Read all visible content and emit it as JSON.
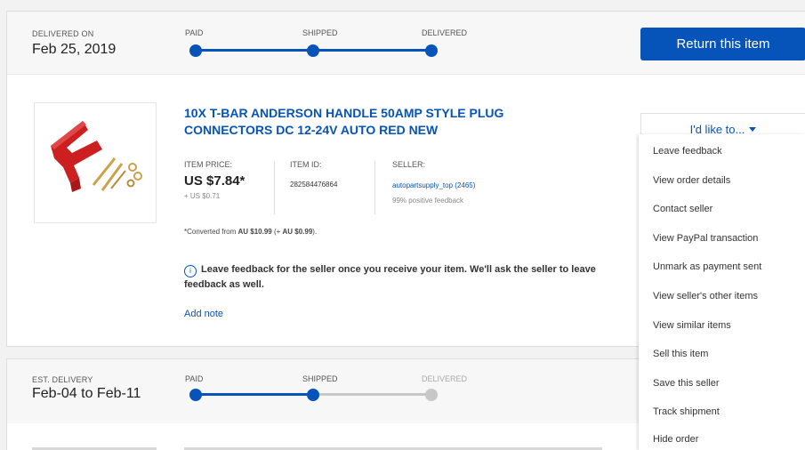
{
  "order1": {
    "date_label": "DELIVERED ON",
    "date_value": "Feb 25, 2019",
    "steps": [
      "PAID",
      "SHIPPED",
      "DELIVERED"
    ],
    "progress_steps_completed": 3,
    "return_button": "Return this item",
    "item": {
      "title": "10x T-BAR ANDERSON HANDLE 50AMP STYLE PLUG CONNECTORS DC 12-24V AUTO RED NEW",
      "price_label": "ITEM PRICE:",
      "price": "US $7.84*",
      "shipping": "+ US $0.71",
      "id_label": "ITEM ID:",
      "id_value": "282584476864",
      "seller_label": "SELLER:",
      "seller_name": "autopartsupply_top (2465)",
      "seller_feedback": "99% positive feedback",
      "converted_prefix": "*Converted from ",
      "converted_amount": "AU $10.99",
      "converted_mid": " (+ ",
      "converted_shipping": "AU $0.99",
      "converted_suffix": ").",
      "info_text": "Leave feedback for the seller once you receive your item. We'll ask the seller to leave feedback as well.",
      "add_note": "Add note"
    },
    "actions": {
      "button_label": "I'd like to...",
      "menu": [
        "Leave feedback",
        "View order details",
        "Contact seller",
        "View PayPal transaction",
        "Unmark as payment sent",
        "View seller's other items",
        "View similar items",
        "Sell this item",
        "Save this seller",
        "Track shipment",
        "Hide order"
      ]
    }
  },
  "order2": {
    "date_label": "EST. DELIVERY",
    "date_value": "Feb-04 to Feb-11",
    "steps": [
      "PAID",
      "SHIPPED",
      "DELIVERED"
    ],
    "progress_steps_completed": 2
  },
  "colors": {
    "accent": "#0654ba",
    "inactive": "#c7c7c7",
    "product_red": "#cc1f1f",
    "brass": "#c9a24a"
  },
  "icons": {
    "info": "info-icon",
    "caret": "caret-down-icon"
  }
}
